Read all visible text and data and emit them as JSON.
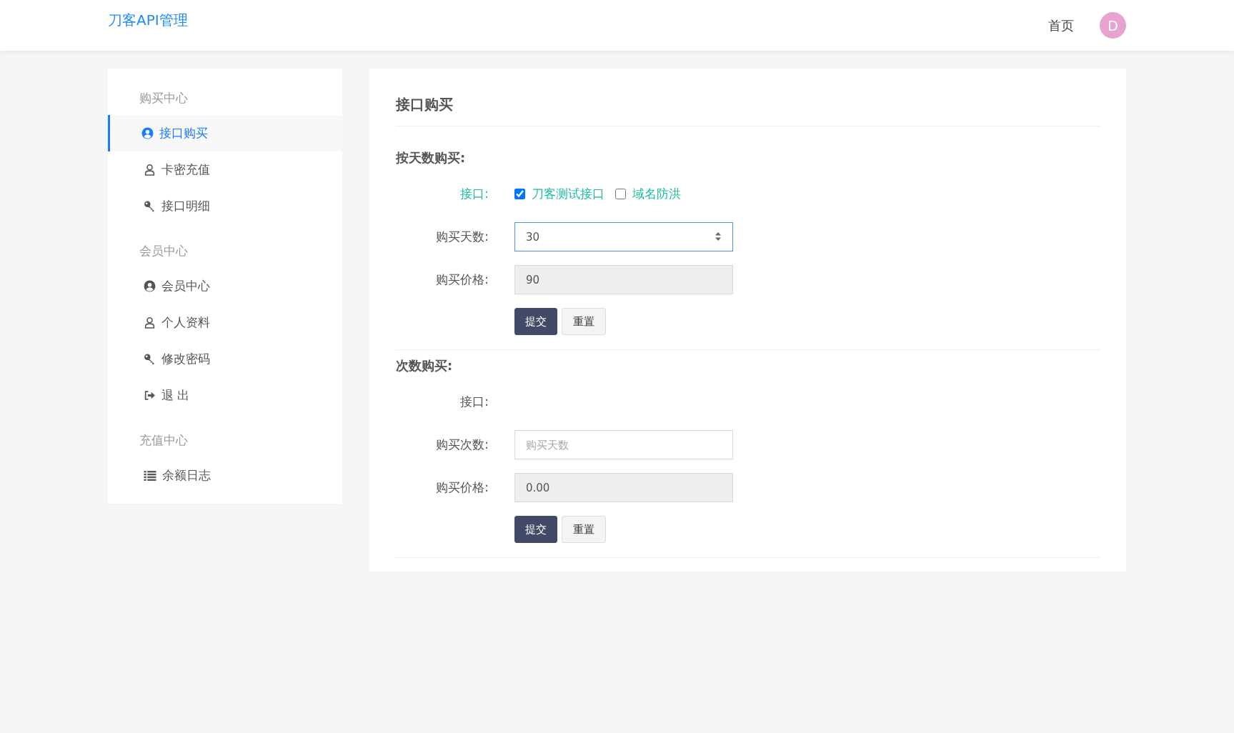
{
  "header": {
    "logo": "刀客API管理",
    "nav_link": "首页",
    "avatar_letter": "D"
  },
  "sidebar": {
    "groups": [
      {
        "title": "购买中心",
        "items": [
          {
            "label": "接口购买",
            "kind": "user-circle",
            "selected": true
          },
          {
            "label": "卡密充值",
            "kind": "user",
            "selected": false
          },
          {
            "label": "接口明细",
            "kind": "key",
            "selected": false
          }
        ]
      },
      {
        "title": "会员中心",
        "items": [
          {
            "label": "会员中心",
            "kind": "user-circle",
            "selected": false
          },
          {
            "label": "个人资料",
            "kind": "user",
            "selected": false
          },
          {
            "label": "修改密码",
            "kind": "key",
            "selected": false
          },
          {
            "label": "退 出",
            "kind": "sign-out",
            "selected": false
          }
        ]
      },
      {
        "title": "充值中心",
        "items": [
          {
            "label": "余额日志",
            "kind": "list",
            "selected": false
          }
        ]
      }
    ]
  },
  "main": {
    "title": "接口购买",
    "sections": [
      {
        "heading": "按天数购买:",
        "interface_label": {
          "text": "接口:",
          "highlighted": true
        },
        "interfaces": [
          {
            "label": "刀客测试接口",
            "checked": true
          },
          {
            "label": "域名防洪",
            "checked": false
          }
        ],
        "quantity": {
          "label": "购买天数:",
          "kind": "number",
          "value": "30",
          "focused": true
        },
        "price": {
          "label": "购买价格:",
          "value": "90",
          "readonly": true
        },
        "submit": "提交",
        "reset": "重置"
      },
      {
        "heading": "次数购买:",
        "interface_label": {
          "text": "接口:",
          "highlighted": false
        },
        "quantity": {
          "label": "购买次数:",
          "kind": "text",
          "placeholder": "购买天数",
          "focused": false
        },
        "price": {
          "label": "购买价格:",
          "value": "0.00",
          "readonly": true
        },
        "submit": "提交",
        "reset": "重置"
      }
    ]
  }
}
